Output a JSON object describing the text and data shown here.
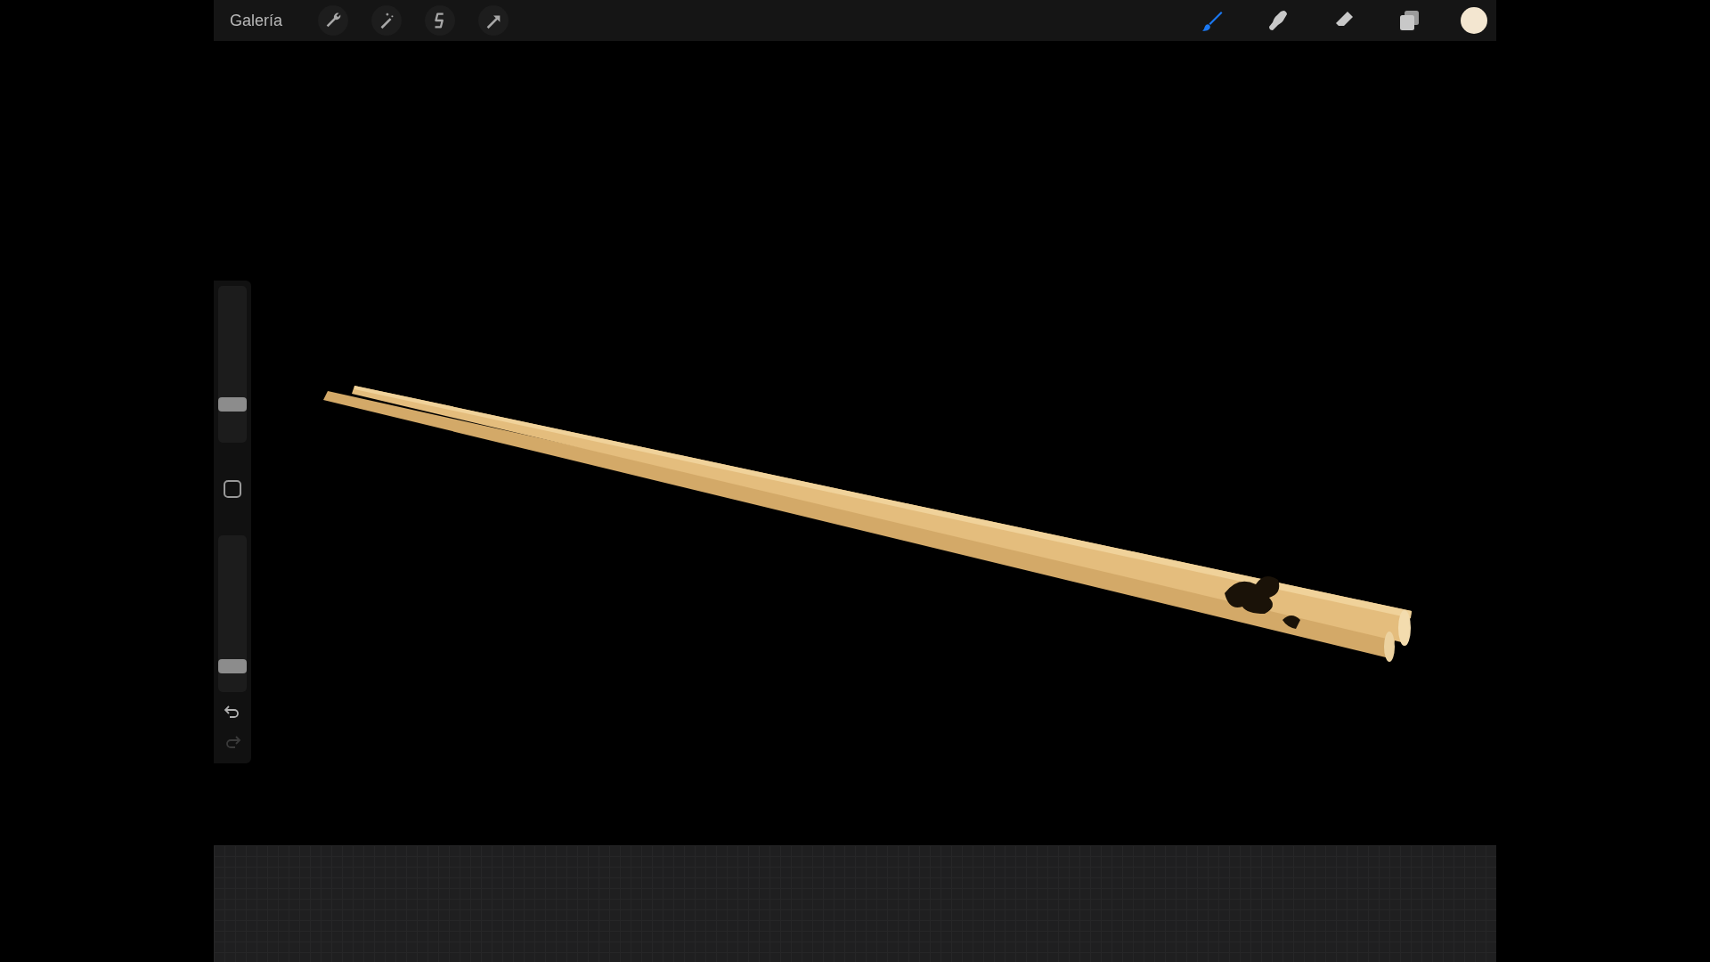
{
  "top_bar": {
    "gallery_label": "Galería",
    "actions": [
      {
        "kind": "wrench"
      },
      {
        "kind": "wand"
      },
      {
        "kind": "selection"
      },
      {
        "kind": "arrow"
      }
    ],
    "tools": [
      {
        "kind": "brush",
        "selected": true
      },
      {
        "kind": "smudge",
        "selected": false
      },
      {
        "kind": "eraser",
        "selected": false
      },
      {
        "kind": "layers",
        "selected": false
      }
    ],
    "current_color": {
      "color": "#f3e6d0"
    }
  },
  "sidebar": {
    "brush_size": {
      "level": 0.2
    },
    "opacity": {
      "level": 0.12
    },
    "undo": {
      "disabled": false
    },
    "redo": {
      "disabled": true
    }
  }
}
